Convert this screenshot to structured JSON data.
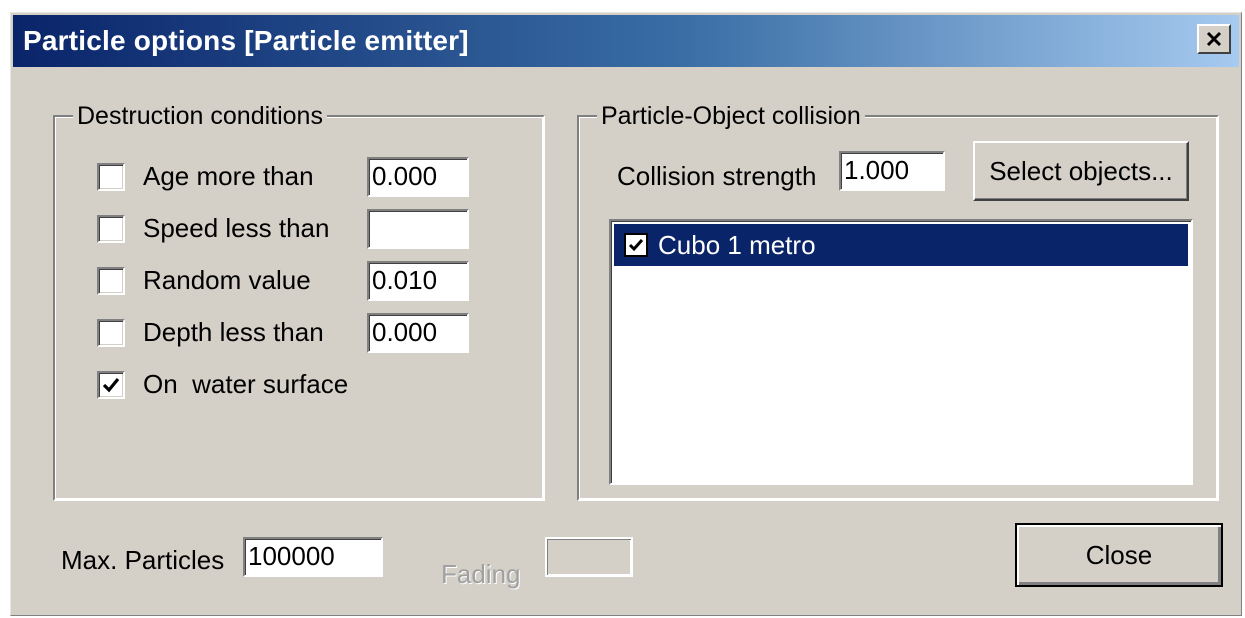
{
  "window": {
    "title": "Particle options [Particle emitter]"
  },
  "destruction": {
    "legend": "Destruction conditions",
    "rows": [
      {
        "label": "Age more than",
        "checked": false,
        "value": "0.000"
      },
      {
        "label": "Speed less than",
        "checked": false,
        "value": ""
      },
      {
        "label": "Random value",
        "checked": false,
        "value": "0.010"
      },
      {
        "label": "Depth less than",
        "checked": false,
        "value": "0.000"
      }
    ],
    "water": {
      "label": "On  water surface",
      "checked": true
    }
  },
  "collision": {
    "legend": "Particle-Object collision",
    "strength_label": "Collision strength",
    "strength_value": "1.000",
    "select_label": "Select objects...",
    "objects": [
      {
        "label": "Cubo 1 metro",
        "checked": true,
        "selected": true
      }
    ]
  },
  "footer": {
    "max_label": "Max. Particles",
    "max_value": "100000",
    "fading_label": "Fading",
    "fading_value": "",
    "close_label": "Close"
  },
  "colors": {
    "titlebar_start": "#0a246a",
    "titlebar_end": "#a6caf0",
    "face": "#d4d0c8",
    "selection": "#0a246a"
  },
  "icons": {
    "close": "close-icon",
    "check": "checkmark-icon"
  }
}
